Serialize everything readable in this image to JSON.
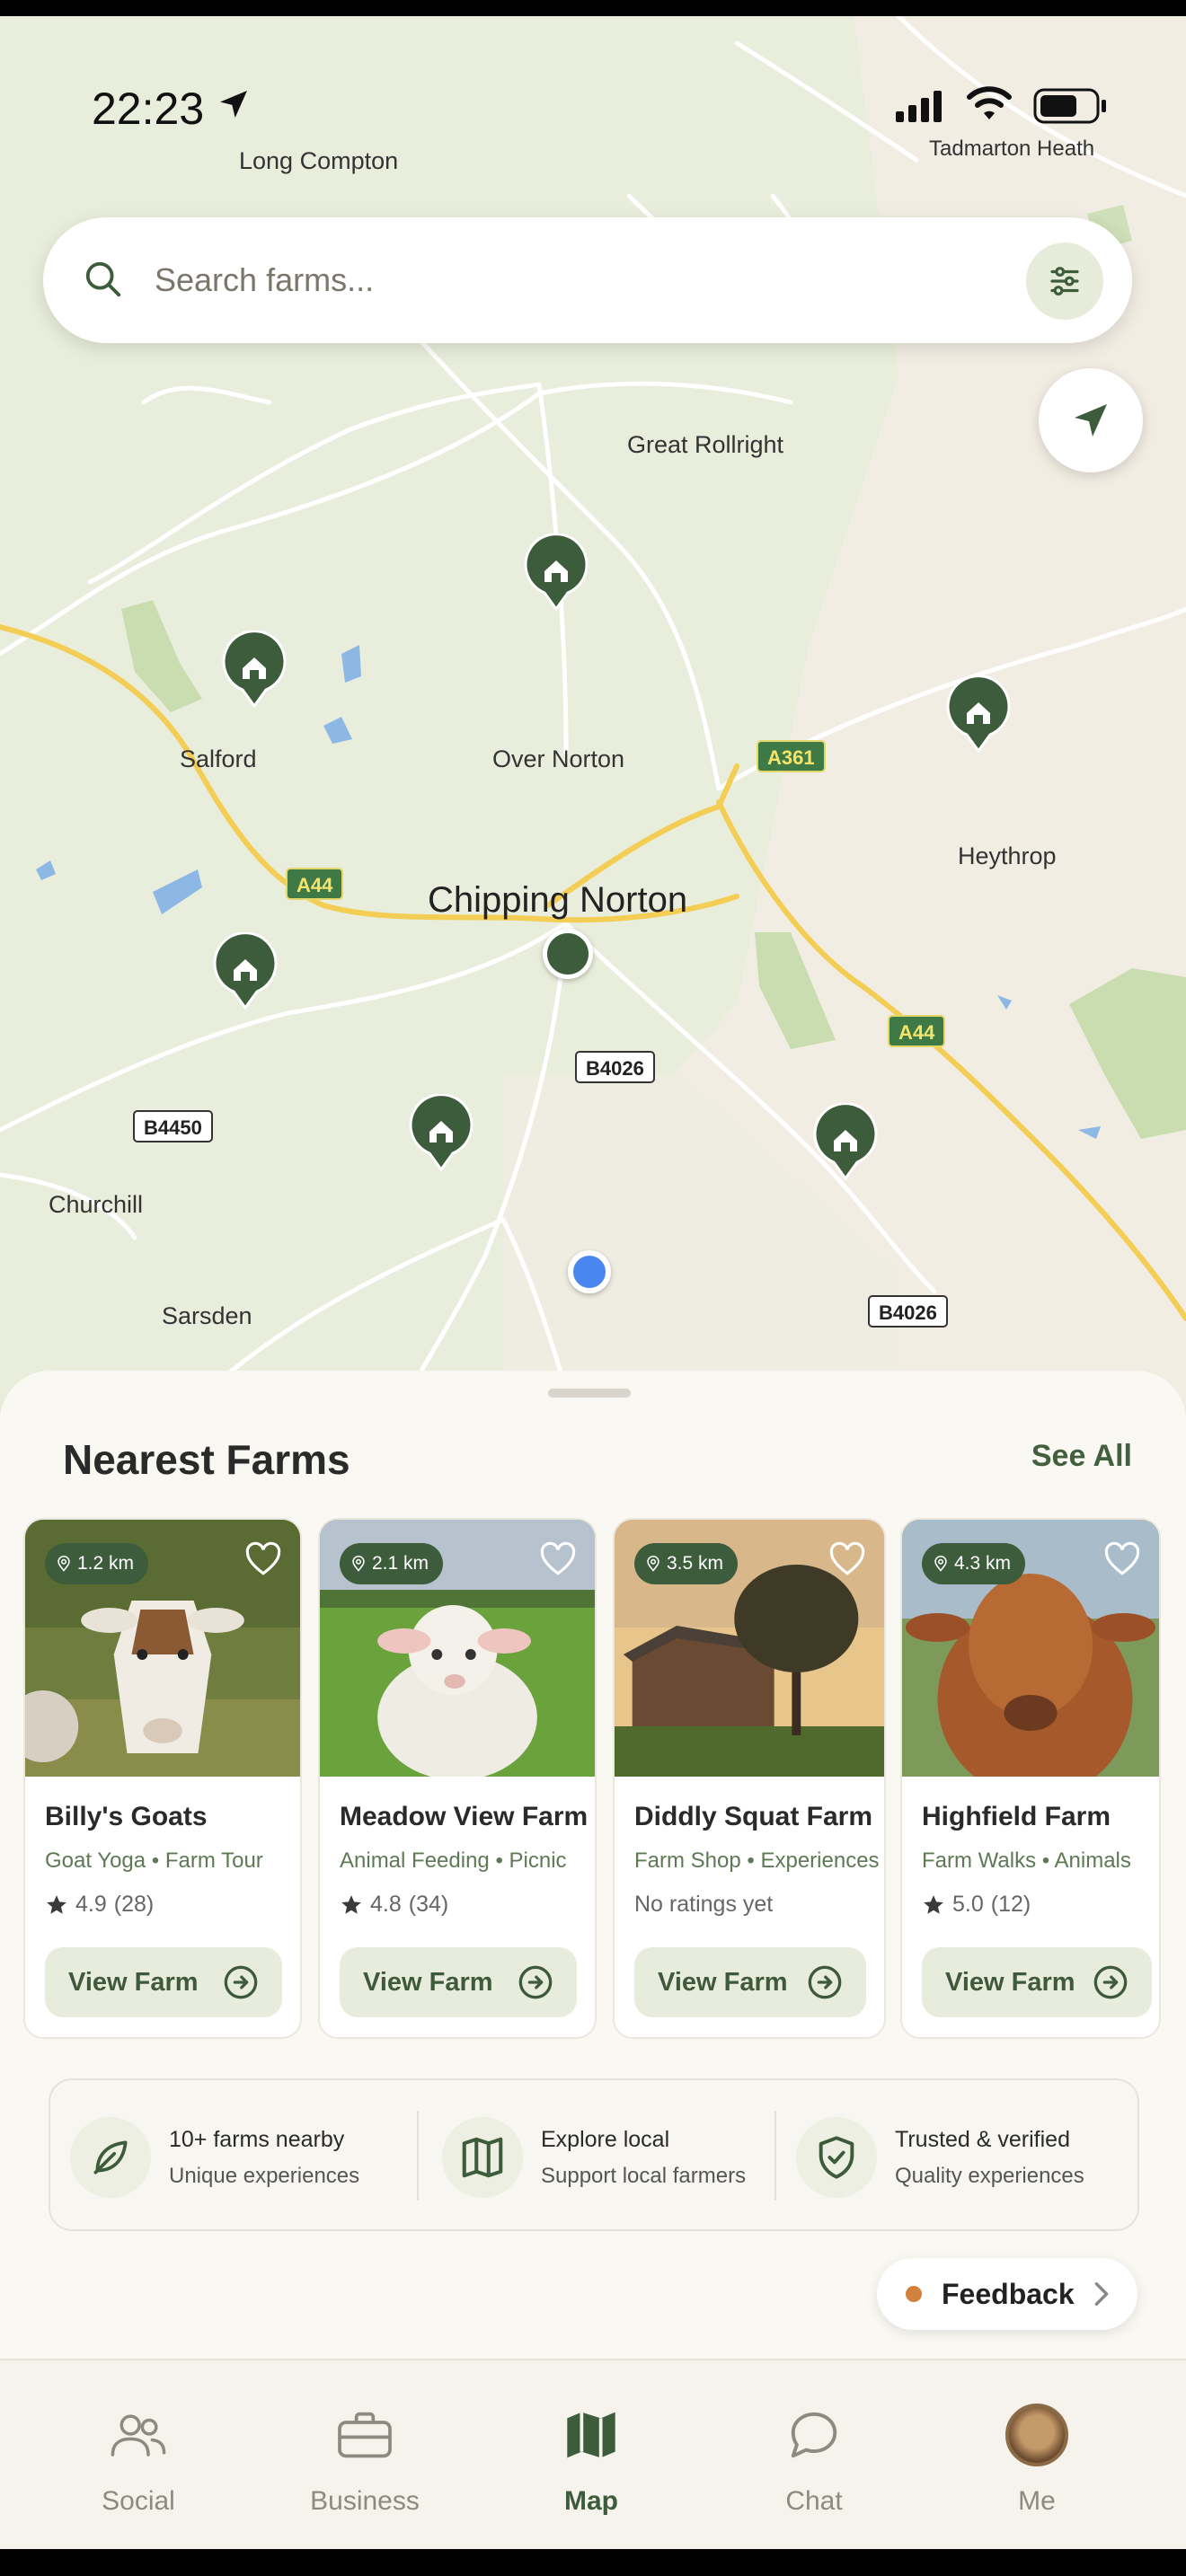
{
  "status_bar": {
    "time": "22:23"
  },
  "map": {
    "places": {
      "long_compton": "Long Compton",
      "tadmarton_heath": "Tadmarton Heath",
      "great_rollright": "Great Rollright",
      "salford": "Salford",
      "over_norton": "Over Norton",
      "chipping_norton": "Chipping Norton",
      "heythrop": "Heythrop",
      "churchill": "Churchill",
      "sarsden": "Sarsden"
    },
    "roads": {
      "a361": "A361",
      "a44_west": "A44",
      "a44_east": "A44",
      "b4026_center": "B4026",
      "b4450": "B4450",
      "b4026_south": "B4026"
    },
    "colors": {
      "pin": "#3d5c3b",
      "user_location": "#4a86f0"
    }
  },
  "search": {
    "placeholder": "Search farms..."
  },
  "sheet": {
    "title": "Nearest Farms",
    "see_all": "See All",
    "cards": [
      {
        "distance": "1.2 km",
        "name": "Billy's Goats",
        "tag1": "Goat Yoga",
        "tag2": "Farm Tour",
        "rating": "4.9",
        "count": "(28)",
        "button": "View Farm"
      },
      {
        "distance": "2.1 km",
        "name": "Meadow View Farm",
        "tag1": "Animal Feeding",
        "tag2": "Picnic",
        "rating": "4.8",
        "count": "(34)",
        "button": "View Farm"
      },
      {
        "distance": "3.5 km",
        "name": "Diddly Squat Farm",
        "tag1": "Farm Shop",
        "tag2": "Experiences",
        "rating_text": "No ratings yet",
        "button": "View Farm"
      },
      {
        "distance": "4.3 km",
        "name": "Highfield Farm",
        "tag1": "Farm Walks",
        "tag2": "Animals",
        "rating": "5.0",
        "count": "(12)",
        "button": "View Farm"
      }
    ],
    "features": [
      {
        "icon": "leaf-icon",
        "title": "10+ farms nearby",
        "subtitle": "Unique experiences"
      },
      {
        "icon": "map-icon",
        "title": "Explore local",
        "subtitle": "Support local farmers"
      },
      {
        "icon": "shield-check-icon",
        "title": "Trusted & verified",
        "subtitle": "Quality experiences"
      }
    ],
    "feedback": "Feedback",
    "tag_separator": "•"
  },
  "tabs": [
    {
      "icon": "people-icon",
      "label": "Social"
    },
    {
      "icon": "briefcase-icon",
      "label": "Business"
    },
    {
      "icon": "map-icon",
      "label": "Map",
      "active": true
    },
    {
      "icon": "chat-icon",
      "label": "Chat"
    },
    {
      "icon": "avatar",
      "label": "Me"
    }
  ]
}
